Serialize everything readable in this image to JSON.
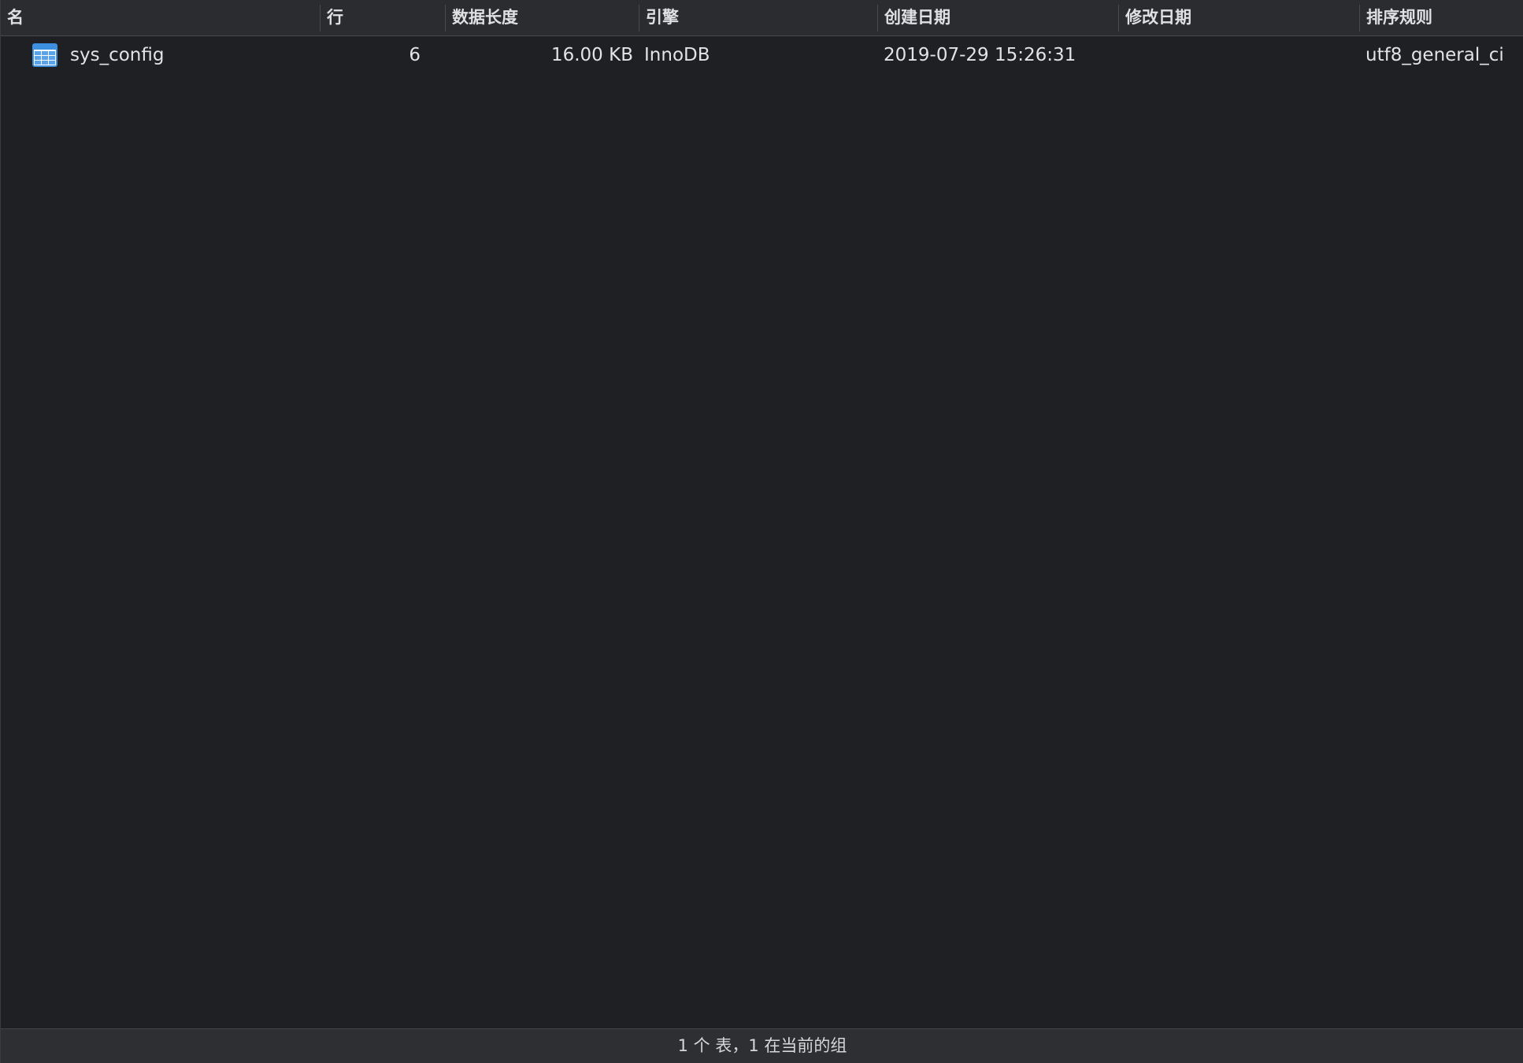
{
  "columns": {
    "name": "名",
    "rows": "行",
    "data_length": "数据长度",
    "engine": "引擎",
    "created": "创建日期",
    "modified": "修改日期",
    "collation": "排序规则"
  },
  "tables": [
    {
      "icon": "table-icon",
      "name": "sys_config",
      "rows": "6",
      "data_length": "16.00 KB",
      "engine": "InnoDB",
      "created": "2019-07-29 15:26:31",
      "modified": "",
      "collation": "utf8_general_ci"
    }
  ],
  "status": {
    "text": "1 个 表，1 在当前的组"
  },
  "colors": {
    "background": "#1f2024",
    "header": "#2b2c30",
    "icon_blue": "#3d8fe0"
  }
}
